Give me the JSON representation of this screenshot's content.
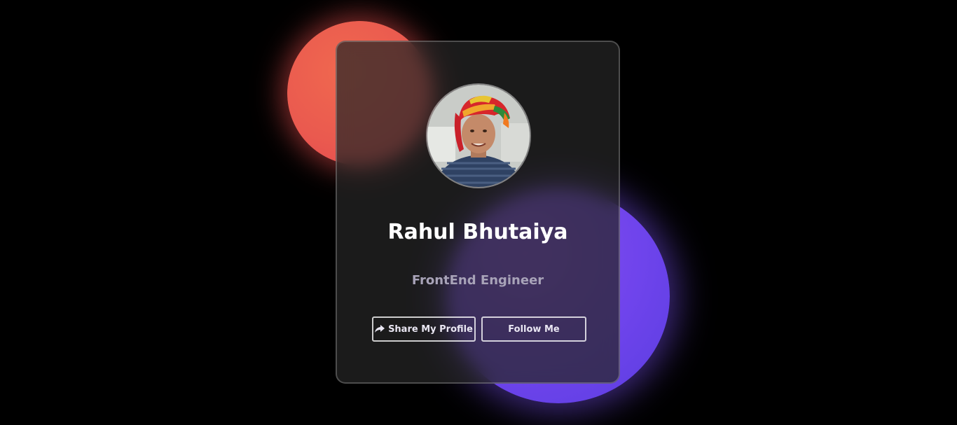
{
  "profile": {
    "name": "Rahul Bhutaiya",
    "role": "FrontEnd Engineer",
    "avatar_icon": "profile-photo"
  },
  "buttons": {
    "share_label": "Share My Profile",
    "share_icon": "share-icon",
    "follow_label": "Follow Me"
  },
  "colors": {
    "background": "#000000",
    "red_blob": "#ea5a4f",
    "purple_blob": "#6f44ec",
    "name_text": "#ffffff",
    "role_text": "#a8a3b8"
  }
}
